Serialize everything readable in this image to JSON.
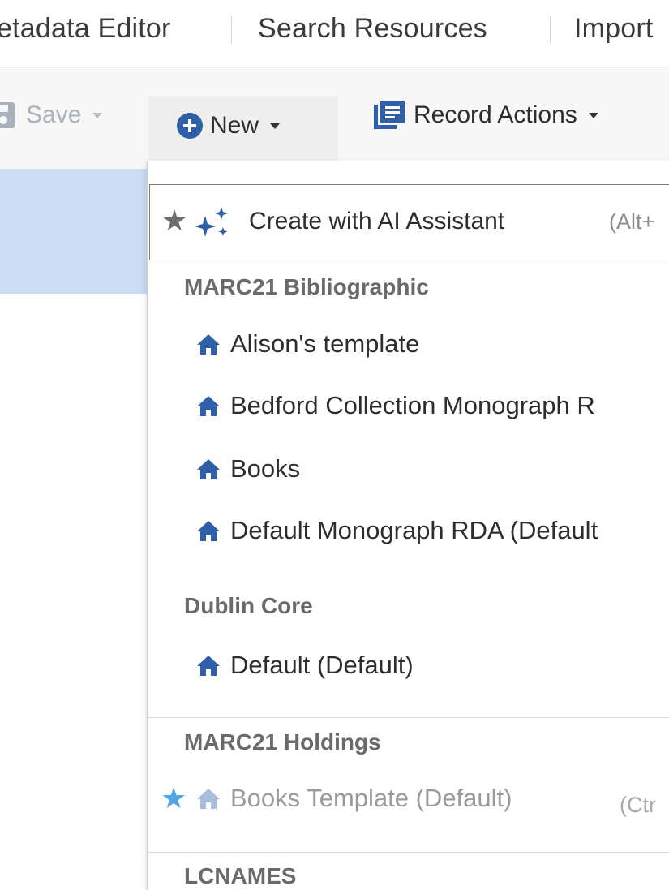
{
  "topnav": {
    "items": [
      "etadata Editor",
      "Search Resources",
      "Import"
    ]
  },
  "toolbar": {
    "save_label": "Save",
    "new_label": "New",
    "record_actions_label": "Record Actions"
  },
  "menu": {
    "ai_assistant": {
      "label": "Create with AI Assistant",
      "shortcut": "(Alt+"
    },
    "groups": [
      {
        "header": "MARC21 Bibliographic",
        "items": [
          "Alison's template",
          "Bedford Collection Monograph R",
          "Books",
          "Default Monograph RDA (Default"
        ]
      },
      {
        "header": "Dublin Core",
        "items": [
          "Default (Default)"
        ]
      },
      {
        "header": "MARC21 Holdings",
        "items": [
          "Books Template (Default)"
        ],
        "shortcut": "(Ctr"
      },
      {
        "header": "LCNAMES",
        "items": []
      }
    ]
  },
  "colors": {
    "accent_blue": "#2f5fa8",
    "selection": "#c9def5",
    "pin_star": "#55a4e6"
  },
  "icons": [
    "save-icon",
    "plus-circle-icon",
    "record-actions-icon",
    "star-icon",
    "sparkles-icon",
    "house-icon",
    "caret-down-icon"
  ]
}
